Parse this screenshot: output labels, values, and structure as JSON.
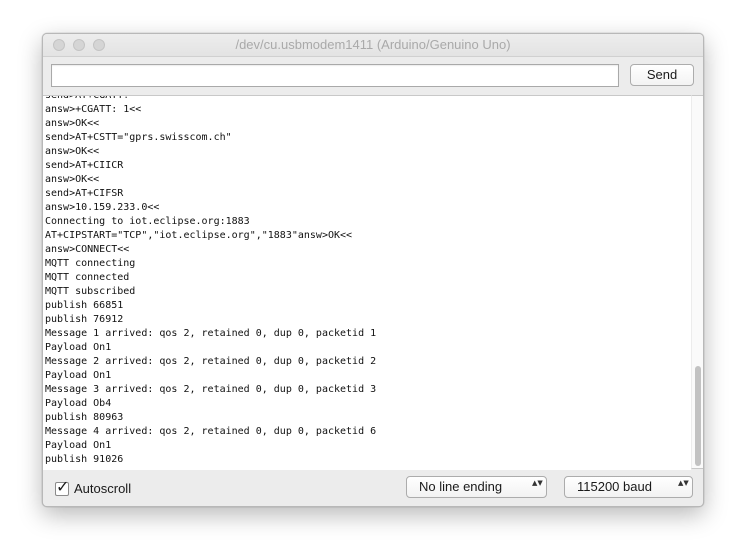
{
  "window": {
    "title": "/dev/cu.usbmodem1411 (Arduino/Genuino Uno)"
  },
  "toolbar": {
    "input_value": "",
    "send_label": "Send"
  },
  "console": {
    "lines": [
      "send>AT+CGATT?",
      "answ>+CGATT: 1<<",
      "answ>OK<<",
      "send>AT+CSTT=\"gprs.swisscom.ch\"",
      "answ>OK<<",
      "send>AT+CIICR",
      "answ>OK<<",
      "send>AT+CIFSR",
      "answ>10.159.233.0<<",
      "Connecting to iot.eclipse.org:1883",
      "AT+CIPSTART=\"TCP\",\"iot.eclipse.org\",\"1883\"answ>OK<<",
      "answ>CONNECT<<",
      "MQTT connecting",
      "MQTT connected",
      "MQTT subscribed",
      "publish 66851",
      "publish 76912",
      "Message 1 arrived: qos 2, retained 0, dup 0, packetid 1",
      "Payload On1",
      "Message 2 arrived: qos 2, retained 0, dup 0, packetid 2",
      "Payload On1",
      "Message 3 arrived: qos 2, retained 0, dup 0, packetid 3",
      "Payload Ob4",
      "publish 80963",
      "Message 4 arrived: qos 2, retained 0, dup 0, packetid 6",
      "Payload On1",
      "publish 91026"
    ]
  },
  "footer": {
    "autoscroll_label": "Autoscroll",
    "autoscroll_checked": true,
    "checkmark_glyph": "✓",
    "line_ending_value": "No line ending",
    "baud_value": "115200 baud",
    "select_arrows": "▲▼"
  },
  "colors": {
    "window_bg": "#ececec",
    "console_bg": "#ffffff",
    "title_text": "#a9a9a9",
    "traffic_light": "#d5d5d5"
  },
  "icons": {
    "window_controls": [
      "close-icon",
      "minimize-icon",
      "zoom-icon"
    ],
    "checkbox": "checkmark-icon",
    "select": "updown-arrows-icon"
  }
}
